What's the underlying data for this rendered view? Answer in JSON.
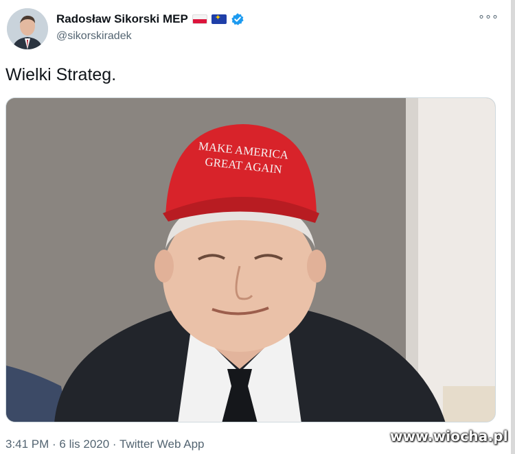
{
  "author": {
    "display_name": "Radosław Sikorski MEP",
    "handle": "@sikorskiradek",
    "flags": [
      "poland-flag-icon",
      "eu-flag-icon"
    ],
    "verified_icon": "verified-badge-icon"
  },
  "more_icon": "more-options-icon",
  "more_label": "∘∘∘",
  "tweet": {
    "text": "Wielki Strateg.",
    "media": {
      "hat_text_line1": "MAKE AMERICA",
      "hat_text_line2": "GREAT AGAIN"
    }
  },
  "meta": {
    "time": "3:41 PM",
    "sep1": " · ",
    "date": "6 lis 2020",
    "sep2": " · ",
    "source": "Twitter Web App"
  },
  "watermark": "www.wiocha.pl",
  "colors": {
    "verified": "#1d9bf0",
    "hat_red": "#d8232a",
    "meta_gray": "#536471"
  }
}
